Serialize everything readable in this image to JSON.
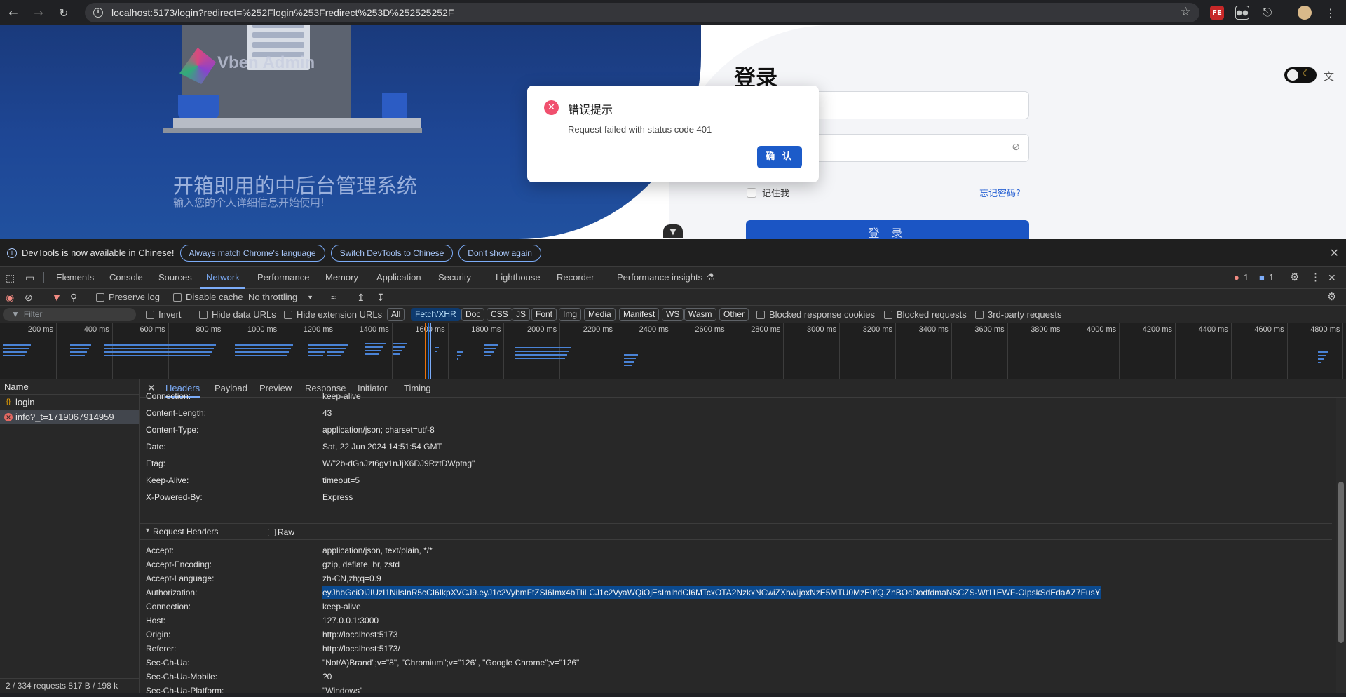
{
  "browser": {
    "url": "localhost:5173/login?redirect=%252Flogin%253Fredirect%253D%252525252F"
  },
  "page": {
    "brand": "Vben Admin",
    "slogan": "开箱即用的中后台管理系统",
    "subslogan": "输入您的个人详细信息开始使用!",
    "login_title": "登录",
    "remember_label": "记住我",
    "forgot_label": "忘记密码?",
    "login_button": "登 录"
  },
  "dialog": {
    "title": "错误提示",
    "message": "Request failed with status code 401",
    "ok": "确 认"
  },
  "devtools": {
    "infobar": {
      "text": "DevTools is now available in Chinese!",
      "btn1": "Always match Chrome's language",
      "btn2": "Switch DevTools to Chinese",
      "btn3": "Don't show again"
    },
    "tabs": [
      "Elements",
      "Console",
      "Sources",
      "Network",
      "Performance",
      "Memory",
      "Application",
      "Security",
      "Lighthouse",
      "Recorder",
      "Performance insights"
    ],
    "errors_count": "1",
    "messages_count": "1",
    "toolbar": {
      "preserve_log": "Preserve log",
      "disable_cache": "Disable cache",
      "throttling": "No throttling"
    },
    "filter": {
      "placeholder": "Filter",
      "invert": "Invert",
      "hide_data_urls": "Hide data URLs",
      "hide_ext_urls": "Hide extension URLs",
      "types": [
        "All",
        "Fetch/XHR",
        "Doc",
        "CSS",
        "JS",
        "Font",
        "Img",
        "Media",
        "Manifest",
        "WS",
        "Wasm",
        "Other"
      ],
      "blocked_cookies": "Blocked response cookies",
      "blocked_requests": "Blocked requests",
      "third_party": "3rd-party requests"
    },
    "timeline_ticks": [
      "200 ms",
      "400 ms",
      "600 ms",
      "800 ms",
      "1000 ms",
      "1200 ms",
      "1400 ms",
      "1600 ms",
      "1800 ms",
      "2000 ms",
      "2200 ms",
      "2400 ms",
      "2600 ms",
      "2800 ms",
      "3000 ms",
      "3200 ms",
      "3400 ms",
      "3600 ms",
      "3800 ms",
      "4000 ms",
      "4200 ms",
      "4400 ms",
      "4600 ms",
      "4800 ms"
    ],
    "requests_header": "Name",
    "requests": [
      {
        "name": "login",
        "status": "ok"
      },
      {
        "name": "info?_t=1719067914959",
        "status": "error"
      }
    ],
    "footer": "2 / 334 requests   817 B / 198 k",
    "detail_tabs": [
      "Headers",
      "Payload",
      "Preview",
      "Response",
      "Initiator",
      "Timing"
    ],
    "response_headers": [
      {
        "k": "Connection:",
        "v": "keep-alive"
      },
      {
        "k": "Content-Length:",
        "v": "43"
      },
      {
        "k": "Content-Type:",
        "v": "application/json; charset=utf-8"
      },
      {
        "k": "Date:",
        "v": "Sat, 22 Jun 2024 14:51:54 GMT"
      },
      {
        "k": "Etag:",
        "v": "W/\"2b-dGnJzt6gv1nJjX6DJ9RztDWptng\""
      },
      {
        "k": "Keep-Alive:",
        "v": "timeout=5"
      },
      {
        "k": "X-Powered-By:",
        "v": "Express"
      }
    ],
    "request_headers_title": "Request Headers",
    "raw_label": "Raw",
    "request_headers": [
      {
        "k": "Accept:",
        "v": "application/json, text/plain, */*"
      },
      {
        "k": "Accept-Encoding:",
        "v": "gzip, deflate, br, zstd"
      },
      {
        "k": "Accept-Language:",
        "v": "zh-CN,zh;q=0.9"
      },
      {
        "k": "Authorization:",
        "v": "eyJhbGciOiJIUzI1NiIsInR5cCI6IkpXVCJ9.eyJ1c2VybmFtZSI6Imx4bTIiLCJ1c2VyaWQiOjEsImlhdCI6MTcxOTA2NzkxNCwiZXhwIjoxNzE5MTU0MzE0fQ.ZnBOcDodfdmaNSCZS-Wt11EWF-OIpskSdEdaAZ7FusY"
      },
      {
        "k": "Connection:",
        "v": "keep-alive"
      },
      {
        "k": "Host:",
        "v": "127.0.0.1:3000"
      },
      {
        "k": "Origin:",
        "v": "http://localhost:5173"
      },
      {
        "k": "Referer:",
        "v": "http://localhost:5173/"
      },
      {
        "k": "Sec-Ch-Ua:",
        "v": "\"Not/A)Brand\";v=\"8\", \"Chromium\";v=\"126\", \"Google Chrome\";v=\"126\""
      },
      {
        "k": "Sec-Ch-Ua-Mobile:",
        "v": "?0"
      },
      {
        "k": "Sec-Ch-Ua-Platform:",
        "v": "\"Windows\""
      }
    ]
  }
}
